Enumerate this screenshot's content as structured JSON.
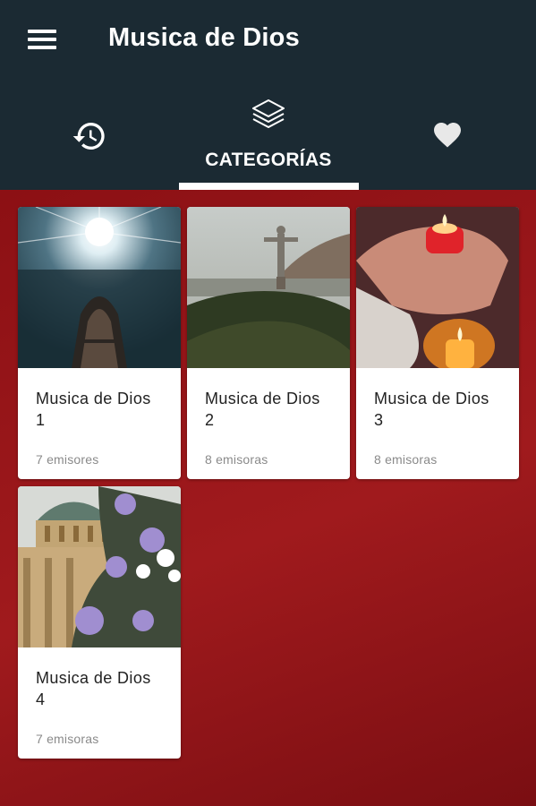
{
  "header": {
    "title": "Musica de Dios",
    "menu_icon": "hamburger-menu-icon"
  },
  "tabs": [
    {
      "icon": "history-icon",
      "label": "",
      "selected": false
    },
    {
      "icon": "layers-icon",
      "label": "CATEGORÍAS",
      "selected": true
    },
    {
      "icon": "heart-icon",
      "label": "",
      "selected": false
    }
  ],
  "categories": [
    {
      "name_line1": "Musica de Dios",
      "name_line2": "1",
      "count": "7 emisores",
      "image": "boat-light-image"
    },
    {
      "name_line1": "Musica de Dios",
      "name_line2": "2",
      "count": "8 emisoras",
      "image": "christ-statue-image"
    },
    {
      "name_line1": "Musica de Dios",
      "name_line2": "3",
      "count": "8 emisoras",
      "image": "candles-image"
    },
    {
      "name_line1": "Musica de Dios",
      "name_line2": "4",
      "count": "7 emisoras",
      "image": "church-flowers-image"
    }
  ],
  "colors": {
    "appbar": "#1b2a33",
    "background": "#9a1519",
    "card": "#ffffff",
    "accent": "#ffffff"
  }
}
